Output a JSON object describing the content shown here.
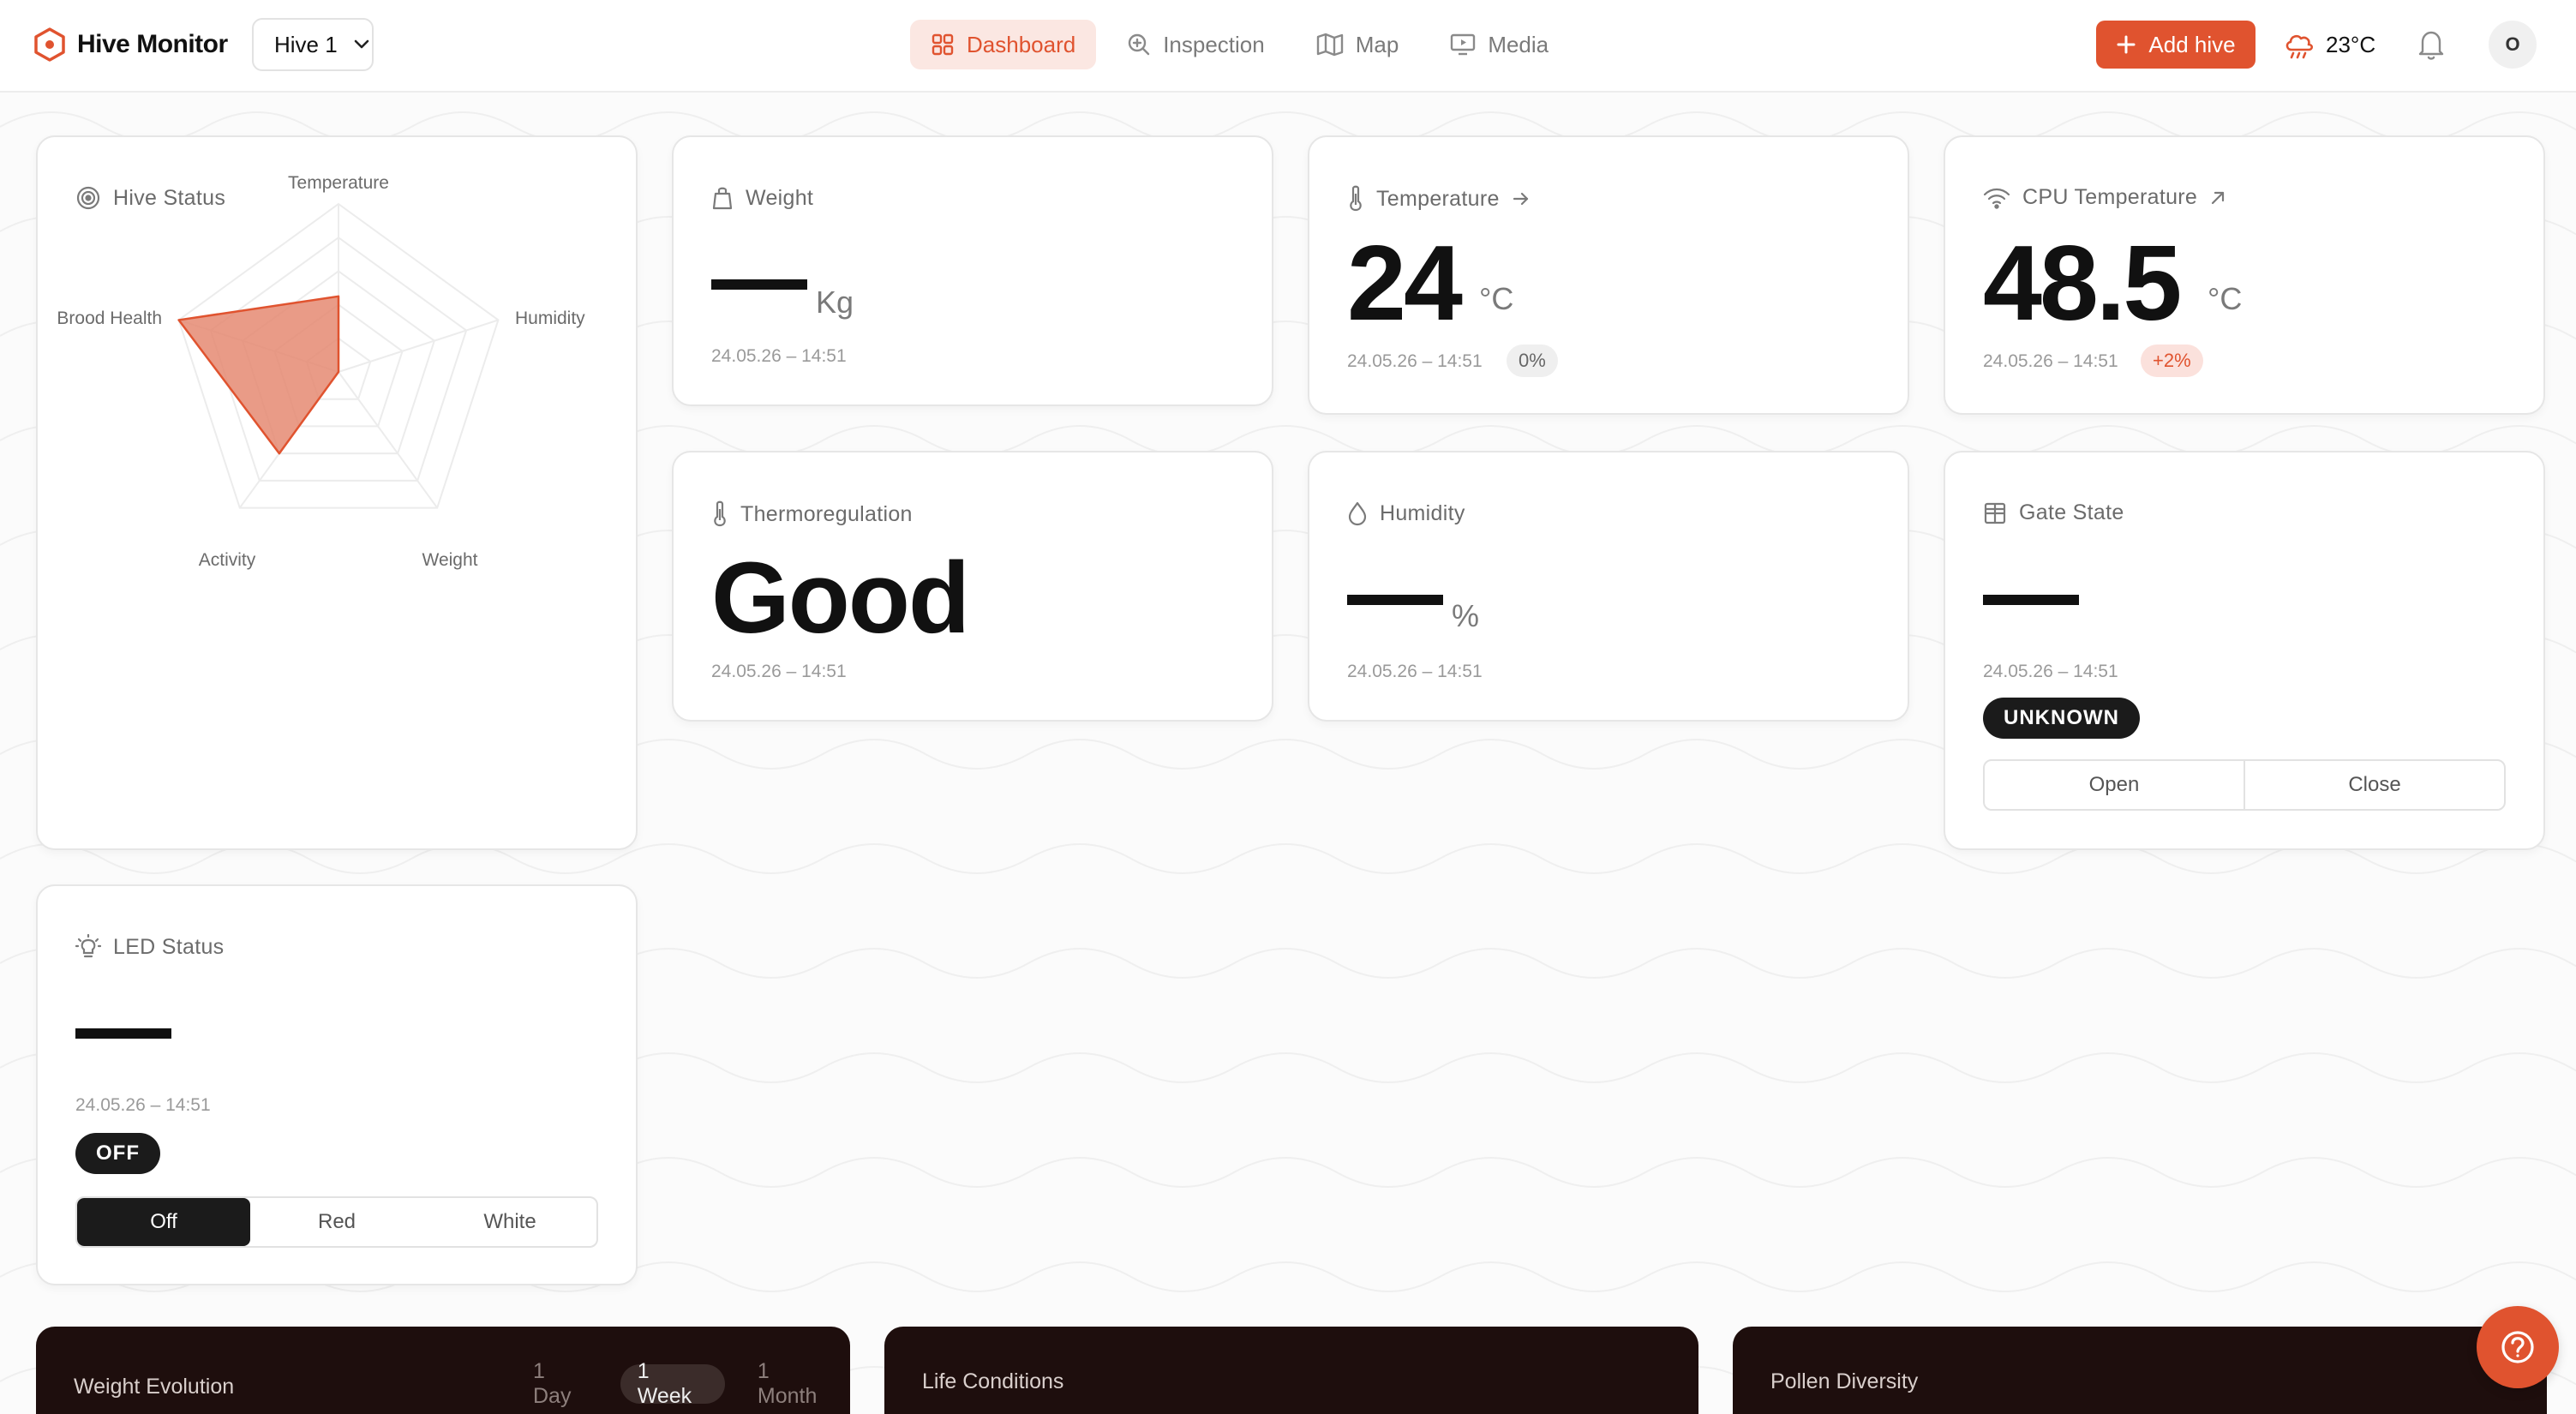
{
  "app": {
    "name": "Hive Monitor"
  },
  "hive_selector": {
    "value": "Hive 1"
  },
  "nav": [
    {
      "label": "Dashboard",
      "icon": "grid-icon",
      "active": true
    },
    {
      "label": "Inspection",
      "icon": "magnify-plus-icon",
      "active": false
    },
    {
      "label": "Map",
      "icon": "map-icon",
      "active": false
    },
    {
      "label": "Media",
      "icon": "monitor-play-icon",
      "active": false
    }
  ],
  "header": {
    "add_hive_label": "Add hive",
    "weather_temp": "23°C",
    "avatar_initial": "O"
  },
  "colors": {
    "accent": "#e0532f",
    "accent_soft": "#fbe7e2",
    "dark_card": "#1e0e0d",
    "radar_fill": "#e58a72"
  },
  "hive_status": {
    "title": "Hive Status",
    "axes": [
      "Temperature",
      "Humidity",
      "Weight",
      "Activity",
      "Brood Health"
    ]
  },
  "weight": {
    "title": "Weight",
    "unit": "Kg",
    "timestamp": "24.05.26 – 14:51"
  },
  "temperature": {
    "title": "Temperature",
    "value": "24",
    "unit": "°C",
    "timestamp": "24.05.26 – 14:51",
    "change": "0%"
  },
  "cpu_temperature": {
    "title": "CPU Temperature",
    "value": "48.5",
    "unit": "°C",
    "timestamp": "24.05.26 – 14:51",
    "change": "+2%"
  },
  "thermoregulation": {
    "title": "Thermoregulation",
    "value": "Good",
    "timestamp": "24.05.26 – 14:51"
  },
  "humidity": {
    "title": "Humidity",
    "unit": "%",
    "timestamp": "24.05.26 – 14:51"
  },
  "gate_state": {
    "title": "Gate State",
    "timestamp": "24.05.26 – 14:51",
    "status": "UNKNOWN",
    "open_label": "Open",
    "close_label": "Close"
  },
  "led_status": {
    "title": "LED Status",
    "timestamp": "24.05.26 – 14:51",
    "status": "OFF",
    "options": [
      "Off",
      "Red",
      "White"
    ],
    "selected": "Off"
  },
  "weight_evolution": {
    "title": "Weight Evolution",
    "ranges": [
      "1 Day",
      "1 Week",
      "1 Month"
    ],
    "selected": "1 Week"
  },
  "life_conditions": {
    "title": "Life Conditions"
  },
  "pollen_diversity": {
    "title": "Pollen Diversity"
  }
}
